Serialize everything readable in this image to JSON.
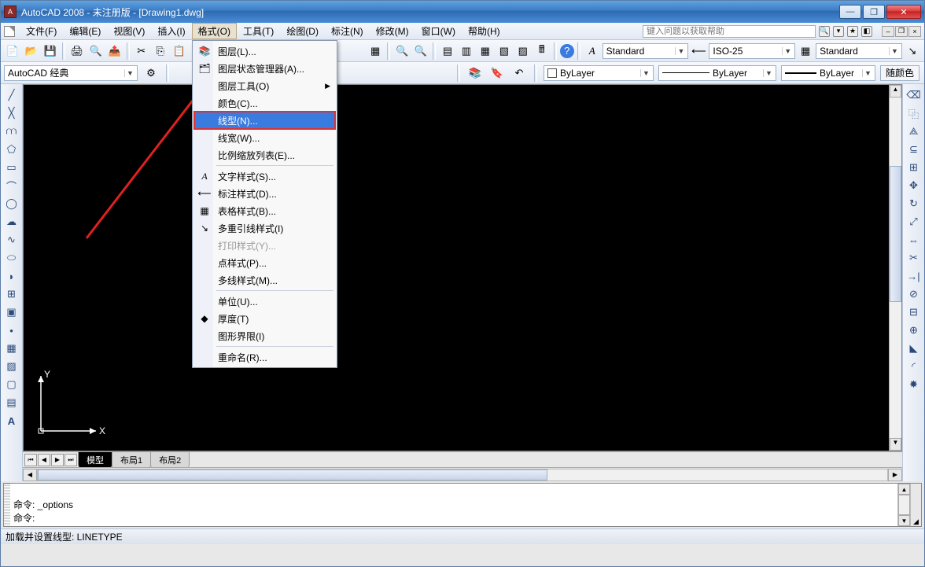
{
  "title": "AutoCAD 2008 - 未注册版 - [Drawing1.dwg]",
  "menubar": {
    "items": [
      "文件(F)",
      "编辑(E)",
      "视图(V)",
      "插入(I)",
      "格式(O)",
      "工具(T)",
      "绘图(D)",
      "标注(N)",
      "修改(M)",
      "窗口(W)",
      "帮助(H)"
    ],
    "active_index": 4,
    "help_search_placeholder": "键入问题以获取帮助"
  },
  "dropdown": {
    "items": [
      {
        "label": "图层(L)...",
        "icon": "layers"
      },
      {
        "label": "图层状态管理器(A)...",
        "icon": "layers-state"
      },
      {
        "label": "图层工具(O)",
        "submenu": true
      },
      {
        "label": "颜色(C)..."
      },
      {
        "label": "线型(N)...",
        "highlight": true
      },
      {
        "label": "线宽(W)..."
      },
      {
        "label": "比例缩放列表(E)..."
      },
      {
        "sep": true
      },
      {
        "label": "文字样式(S)...",
        "icon": "text-style"
      },
      {
        "label": "标注样式(D)...",
        "icon": "dim-style"
      },
      {
        "label": "表格样式(B)...",
        "icon": "table-style"
      },
      {
        "label": "多重引线样式(I)",
        "icon": "mleader-style"
      },
      {
        "label": "打印样式(Y)...",
        "disabled": true
      },
      {
        "label": "点样式(P)..."
      },
      {
        "label": "多线样式(M)..."
      },
      {
        "sep": true
      },
      {
        "label": "单位(U)..."
      },
      {
        "label": "厚度(T)",
        "icon": "thickness"
      },
      {
        "label": "图形界限(I)"
      },
      {
        "sep": true
      },
      {
        "label": "重命名(R)..."
      }
    ]
  },
  "styles_row": {
    "text_style": "Standard",
    "dim_style": "ISO-25",
    "table_style": "Standard"
  },
  "workspace": {
    "current": "AutoCAD 经典"
  },
  "properties": {
    "color_label": "ByLayer",
    "linetype_label": "ByLayer",
    "lineweight_label": "ByLayer",
    "plotcolor_button": "随颜色"
  },
  "tabs": {
    "items": [
      "模型",
      "布局1",
      "布局2"
    ],
    "active_index": 0
  },
  "command": {
    "line1": "命令: _options",
    "line2": "命令:"
  },
  "statusbar": {
    "text": "加载并设置线型:  LINETYPE"
  },
  "ucs": {
    "x_label": "X",
    "y_label": "Y"
  }
}
